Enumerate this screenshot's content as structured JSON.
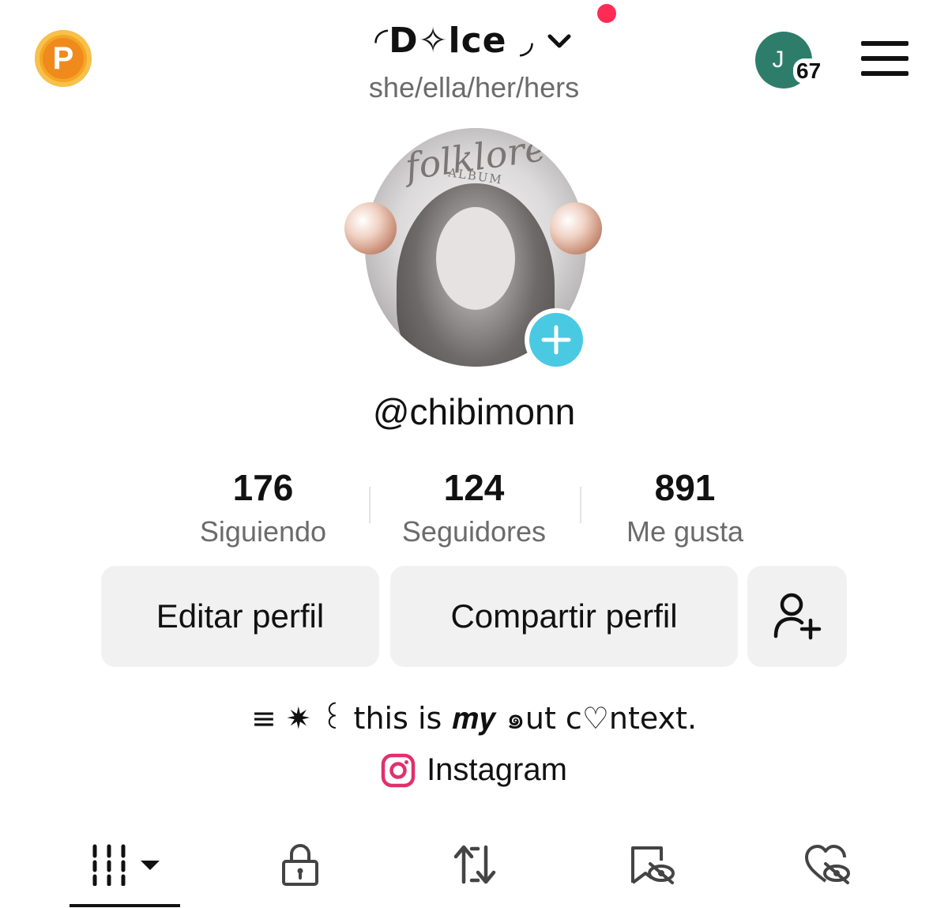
{
  "header": {
    "coin_letter": "P",
    "display_name": "◜D✧lce ◞",
    "pronouns": "she/ella/her/hers",
    "account_initial": "J",
    "account_count": "67"
  },
  "profile": {
    "photo_title": "folklore",
    "photo_subtitle": "ALBUM",
    "username": "@chibimonn"
  },
  "stats": [
    {
      "value": "176",
      "label": "Siguiendo"
    },
    {
      "value": "124",
      "label": "Seguidores"
    },
    {
      "value": "891",
      "label": "Me gusta"
    }
  ],
  "actions": {
    "edit_label": "Editar perfil",
    "share_label": "Compartir perfil"
  },
  "bio": "≡ ✷ ꒰ this is 𝒎𝒚 ๑ut c♡ntext.",
  "link": {
    "label": "Instagram",
    "icon": "instagram-icon"
  },
  "tabs": [
    {
      "icon": "videos-grid-icon",
      "active": true
    },
    {
      "icon": "lock-icon",
      "active": false
    },
    {
      "icon": "repost-icon",
      "active": false
    },
    {
      "icon": "favorites-hidden-icon",
      "active": false
    },
    {
      "icon": "liked-hidden-icon",
      "active": false
    }
  ],
  "colors": {
    "accent_red": "#fe2c55",
    "add_blue": "#4ac9e3",
    "coin_orange": "#f5a623",
    "avatar_green": "#2e7d6b",
    "button_bg": "#f1f1f2"
  }
}
